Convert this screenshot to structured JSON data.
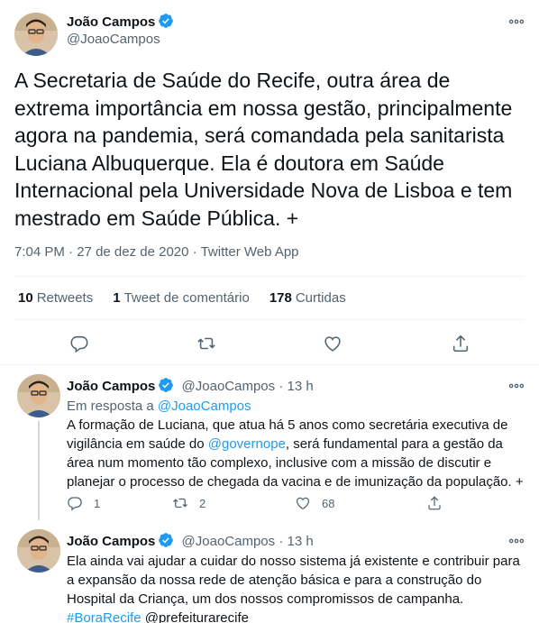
{
  "main_tweet": {
    "author_name": "João Campos",
    "author_handle": "@JoaoCampos",
    "text": "A Secretaria de Saúde do Recife, outra área de extrema importância em nossa gestão, principalmente agora na pandemia, será comandada pela sanitarista Luciana Albuquerque. Ela é doutora em Saúde Internacional pela Universidade Nova de Lisboa e tem mestrado em Saúde Pública. +",
    "time": "7:04 PM",
    "date": "27 de dez de 2020",
    "source": "Twitter Web App",
    "separator": "·",
    "stats": {
      "retweets_count": "10",
      "retweets_label": "Retweets",
      "quotes_count": "1",
      "quotes_label": "Tweet de comentário",
      "likes_count": "178",
      "likes_label": "Curtidas"
    }
  },
  "replies": [
    {
      "author_name": "João Campos",
      "author_handle": "@JoaoCampos",
      "separator": "·",
      "age": "13 h",
      "reply_to_prefix": "Em resposta a",
      "reply_to_handle": "@JoaoCampos",
      "text_before_mention": "A formação de Luciana, que atua há 5 anos como secretária executiva de vigilância em saúde do",
      "mention": "@governope",
      "text_after_mention": ", será fundamental para a gestão da área num momento tão complexo, inclusive com a missão de discutir e planejar o processo de chegada da vacina e de imunização da população. +",
      "reply_count": "1",
      "retweet_count": "2",
      "like_count": "68"
    },
    {
      "author_name": "João Campos",
      "author_handle": "@JoaoCampos",
      "separator": "·",
      "age": "13 h",
      "text": "Ela ainda vai ajudar a cuidar do nosso sistema já existente e contribuir para a expansão da nossa rede de atenção básica e para a construção do Hospital da Criança, um dos nossos compromissos de campanha.",
      "hashtag": "#BoraRecife",
      "mention": "@prefeiturarecife"
    }
  ],
  "colors": {
    "accent": "#1d9bf0",
    "text": "#0f1419",
    "muted": "#536471",
    "divider": "#eff3f4"
  },
  "icons": [
    "verified-badge-icon",
    "more-icon",
    "reply-icon",
    "retweet-icon",
    "like-icon",
    "share-icon"
  ]
}
